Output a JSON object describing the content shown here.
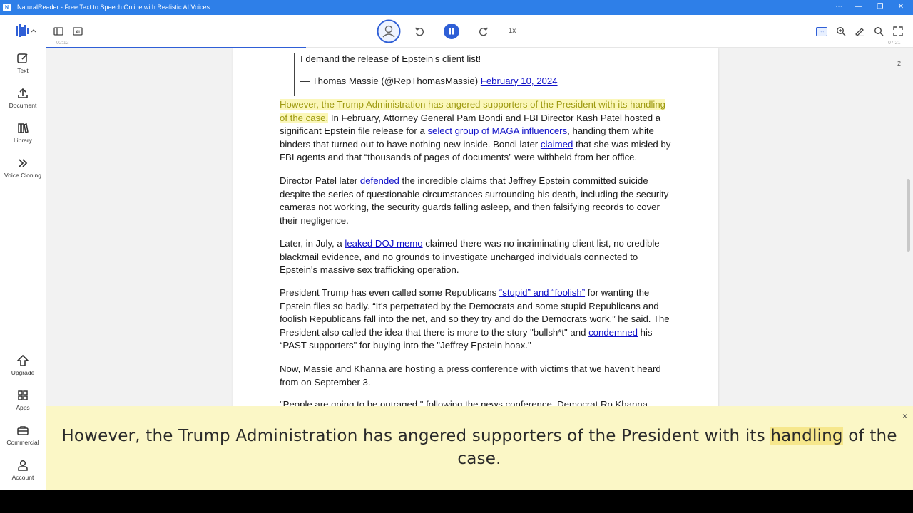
{
  "window": {
    "title": "NaturalReader - Free Text to Speech Online with Realistic AI Voices",
    "app_icon_letter": "N"
  },
  "sidebar": {
    "items": [
      {
        "label": "Text",
        "icon": "pencil-square-icon"
      },
      {
        "label": "Document",
        "icon": "upload-icon"
      },
      {
        "label": "Library",
        "icon": "books-icon"
      },
      {
        "label": "Voice Cloning",
        "icon": "chevrons-right-icon"
      },
      {
        "label": "Upgrade",
        "icon": "upgrade-arrow-icon"
      },
      {
        "label": "Apps",
        "icon": "grid-icon"
      },
      {
        "label": "Commercial",
        "icon": "briefcase-icon"
      },
      {
        "label": "Account",
        "icon": "person-icon"
      }
    ]
  },
  "toolbar": {
    "speed": "1x",
    "elapsed": "02:12",
    "total": "07:21",
    "progress": 0.3
  },
  "document": {
    "page_number": "2",
    "quote_line1": "I demand the release of Epstein's client list!",
    "quote_author": "— Thomas Massie (@RepThomasMassie) ",
    "quote_date_link": "February 10, 2024",
    "p1_highlight": "However, the Trump Administration has angered supporters of the President with its handling of the case.",
    "p1_a": " In February, Attorney General Pam Bondi and FBI Director Kash Patel hosted a significant Epstein file release for a ",
    "p1_link1": "select group of MAGA influencers",
    "p1_b": ", handing them white binders that turned out to have nothing new inside. Bondi later ",
    "p1_link2": "claimed",
    "p1_c": " that she was misled by FBI agents and that “thousands of pages of documents” were withheld from her office.",
    "p2_a": "Director Patel later ",
    "p2_link": "defended",
    "p2_b": " the incredible claims that Jeffrey Epstein committed suicide despite the series of questionable circumstances surrounding his death, including the security cameras not working, the security guards falling asleep, and then falsifying records to cover their negligence.",
    "p3_a": "Later, in July, a ",
    "p3_link": "leaked DOJ memo",
    "p3_b": " claimed there was no incriminating client list, no credible blackmail evidence, and no grounds to investigate uncharged individuals connected to Epstein's massive sex trafficking operation.",
    "p4_a": "President Trump has even called some Republicans ",
    "p4_link1": "“stupid” and “foolish”",
    "p4_b": " for wanting the Epstein files so badly. “It's perpetrated by the Democrats and some stupid Republicans and foolish Republicans fall into the net, and so they try and do the Democrats work,” he said. The President also called the idea that there is more to the story \"bullsh*t\" and ",
    "p4_link2": "condemned",
    "p4_c": " his “PAST supporters\" for buying into the \"Jeffrey Epstein hoax.\"",
    "p5": "Now, Massie and Khanna are hosting a press conference with victims that we haven't heard from on September 3.",
    "p6": "\"People are going to be outraged,\" following the news conference, Democrat Ro Khanna"
  },
  "caption": {
    "before": "However, the Trump Administration has angered supporters of the President with its ",
    "current_word": "handling",
    "after": " of the case.",
    "close": "×"
  },
  "colors": {
    "titlebar": "#2e7fe8",
    "accent": "#2f5fd6",
    "highlight": "#fbf7b9",
    "caption_bg": "#fbf7c6"
  }
}
